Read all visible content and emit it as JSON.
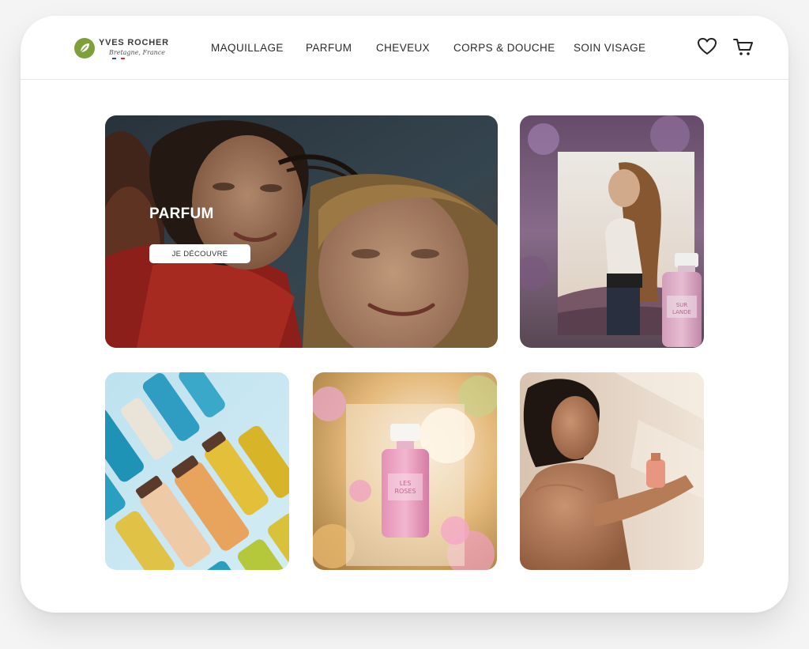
{
  "brand": {
    "name": "YVES ROCHER",
    "tagline": "Bretagne, France",
    "logo_color": "#7ea03a"
  },
  "nav": {
    "items": [
      {
        "label": "MAQUILLAGE"
      },
      {
        "label": "PARFUM"
      },
      {
        "label": "CHEVEUX"
      },
      {
        "label": "CORPS & DOUCHE"
      },
      {
        "label": "SOIN VISAGE"
      }
    ]
  },
  "header_icons": {
    "wishlist": "heart-icon",
    "cart": "cart-icon"
  },
  "hero": {
    "title": "PARFUM",
    "cta_label": "JE DÉCOUVRE"
  },
  "tiles": [
    {
      "subject": "hero-couple-photo"
    },
    {
      "subject": "woman-field-perfume-photo"
    },
    {
      "subject": "shower-gel-bottles-photo"
    },
    {
      "subject": "pink-perfume-bottle-photo"
    },
    {
      "subject": "woman-perfume-spray-photo"
    }
  ],
  "product_labels": {
    "bottle_small": "SUR LA LANDE",
    "bottle_pink": "LES ROSES"
  },
  "colors": {
    "accent": "#7ea03a",
    "text": "#2b2b2b",
    "background": "#ffffff"
  }
}
